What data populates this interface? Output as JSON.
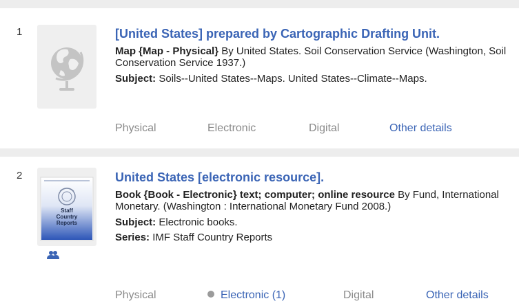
{
  "results": [
    {
      "number": "1",
      "title": "[United States] prepared by Cartographic Drafting Unit.",
      "format_bold": "Map {Map - Physical}",
      "format_rest": " By United States. Soil Conservation Service (Washington, Soil Conservation Service 1937.)",
      "subject_label": "Subject:",
      "subject_value": " Soils--United States--Maps. United States--Climate--Maps.",
      "thumbnail_icon": "globe-icon",
      "actions": {
        "physical": "Physical",
        "electronic": "Electronic",
        "digital": "Digital",
        "other": "Other details"
      }
    },
    {
      "number": "2",
      "title": "United States [electronic resource].",
      "format_bold": "Book {Book - Electronic} text; computer; online resource",
      "format_rest": " By Fund, International Monetary. (Washington : International Monetary Fund 2008.)",
      "subject_label": "Subject:",
      "subject_value": " Electronic books.",
      "series_label": "Series:",
      "series_value": " IMF Staff Country Reports",
      "cover_text": "Staff Country Reports",
      "people_icon": "people-icon",
      "actions": {
        "physical": "Physical",
        "electronic": "Electronic (1)",
        "digital": "Digital",
        "other": "Other details"
      }
    }
  ],
  "colors": {
    "link": "#3a64b5",
    "disabled": "#8a8a8a",
    "divider": "#ededed"
  }
}
